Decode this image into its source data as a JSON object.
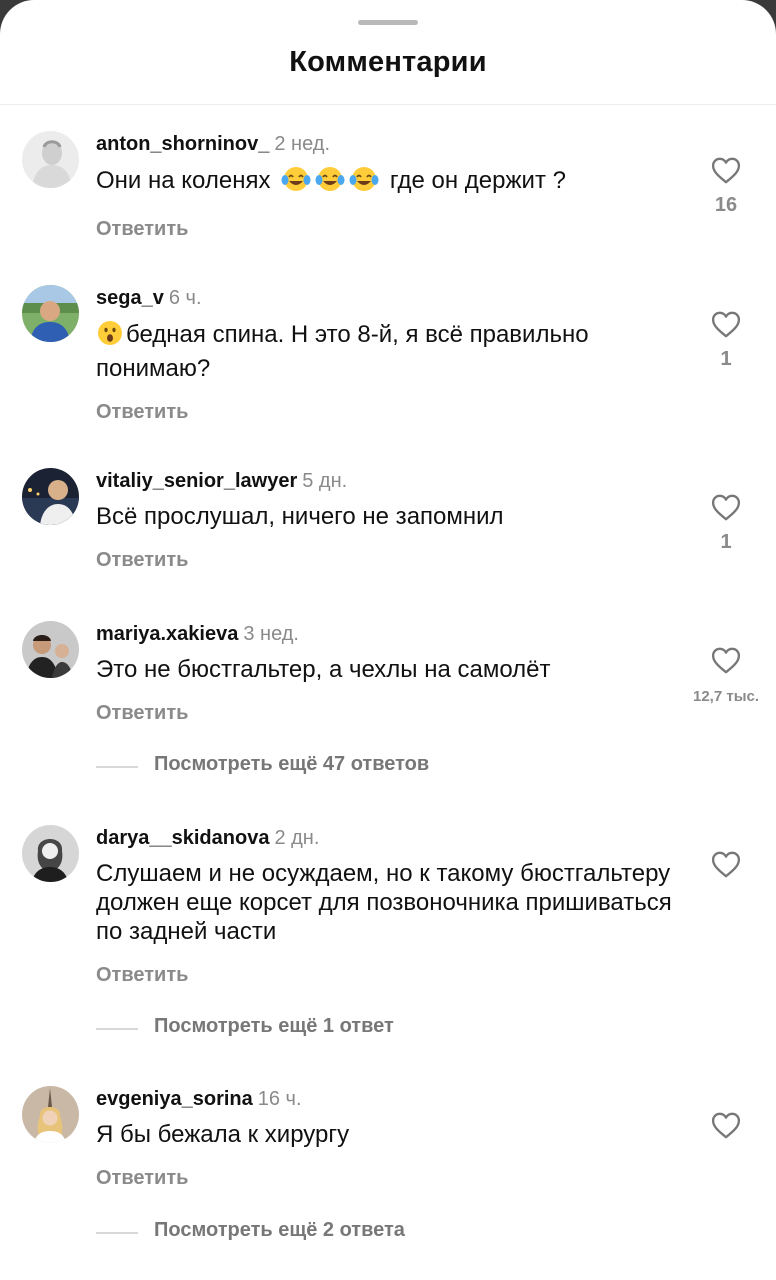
{
  "header": {
    "title": "Комментарии"
  },
  "reply_label": "Ответить",
  "comments": [
    {
      "username": "anton_shorninov_",
      "time": "2 нед.",
      "text_before": "Они на коленях",
      "emojis": [
        "face-with-tears-of-joy",
        "face-with-tears-of-joy",
        "face-with-tears-of-joy"
      ],
      "text_after": "где он держит ?",
      "likes": "16"
    },
    {
      "username": "sega_v",
      "time": "6 ч.",
      "emojis": [
        "face-with-open-mouth"
      ],
      "text_after": "бедная спина. Н это 8-й, я всё правильно понимаю?",
      "likes": "1"
    },
    {
      "username": "vitaliy_senior_lawyer",
      "time": "5 дн.",
      "text": "Всё прослушал, ничего не запомнил",
      "likes": "1"
    },
    {
      "username": "mariya.xakieva",
      "time": "3 нед.",
      "text": "Это не бюстгальтер, а чехлы на самолёт",
      "likes": "12,7 тыс.",
      "view_more": "Посмотреть ещё 47 ответов"
    },
    {
      "username": "darya__skidanova",
      "time": "2 дн.",
      "text": "Слушаем и не осуждаем, но к такому бюстгальтеру должен еще корсет для позвоночника пришиваться по задней части",
      "view_more": "Посмотреть ещё 1 ответ"
    },
    {
      "username": "evgeniya_sorina",
      "time": "16 ч.",
      "text": "Я бы бежала к хирургу",
      "view_more": "Посмотреть ещё 2 ответа"
    }
  ]
}
